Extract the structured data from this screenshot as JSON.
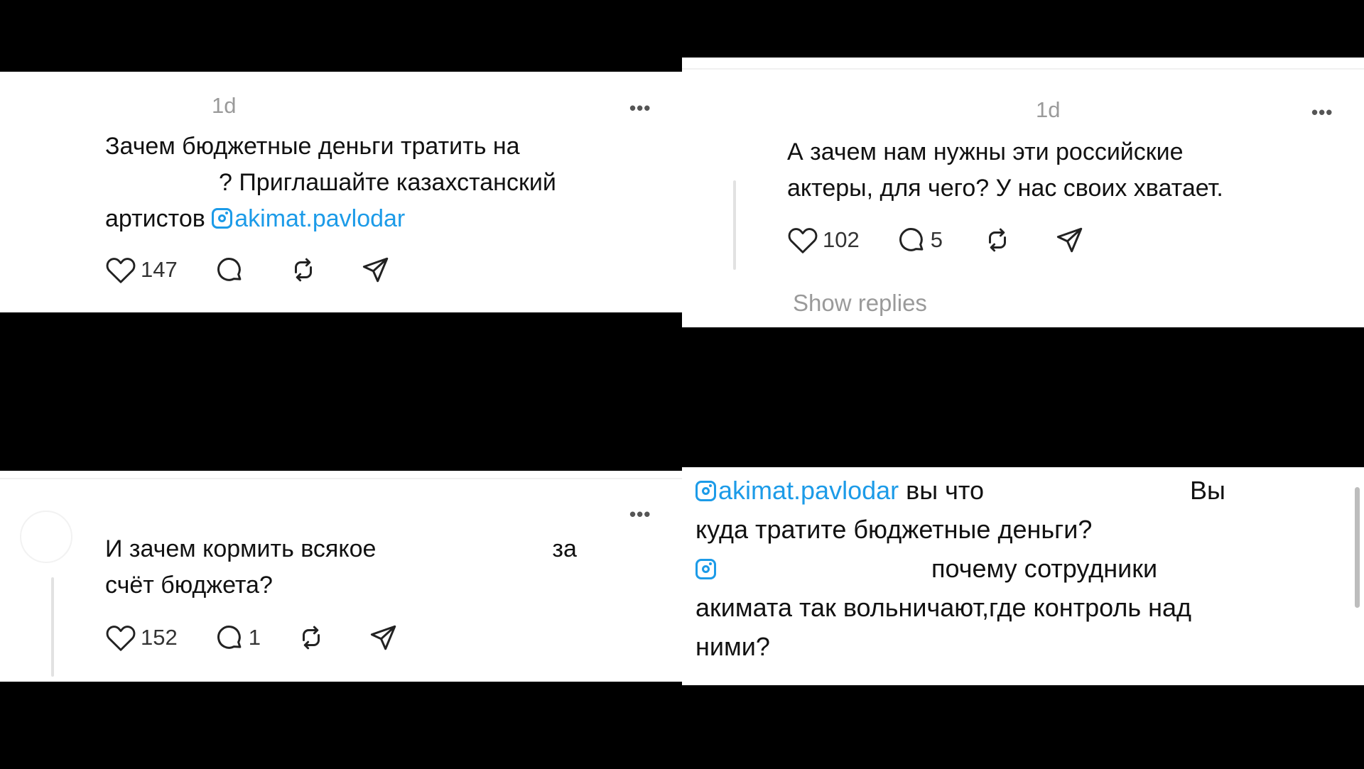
{
  "posts": [
    {
      "time": "1d",
      "more": "•••",
      "lines": [
        "Зачем бюджетные деньги тратить на",
        "? Приглашайте казахстанский"
      ],
      "line3_prefix": "артистов ",
      "mention": "akimat.pavlodar",
      "likes": "147",
      "comments": ""
    },
    {
      "time": "1d",
      "more": "•••",
      "lines": [
        "А зачем нам нужны эти российские",
        "актеры, для чего? У нас своих хватает."
      ],
      "likes": "102",
      "comments": "5",
      "show_replies": "Show replies"
    },
    {
      "more": "•••",
      "lines": [
        "И зачем кормить всякое",
        "за",
        "счёт бюджета?"
      ],
      "likes": "152",
      "comments": "1"
    },
    {
      "mention": "akimat.pavlodar",
      "line1_rest": "вы что",
      "line1_end": "Вы",
      "line2": "куда тратите бюджетные деньги?",
      "line3_rest": "почему сотрудники",
      "line4": "акимата так вольничают,где контроль над",
      "line5": "ними?"
    }
  ],
  "icons": [
    "heart-icon",
    "comment-icon",
    "repost-icon",
    "share-icon",
    "instagram-icon",
    "more-icon"
  ]
}
